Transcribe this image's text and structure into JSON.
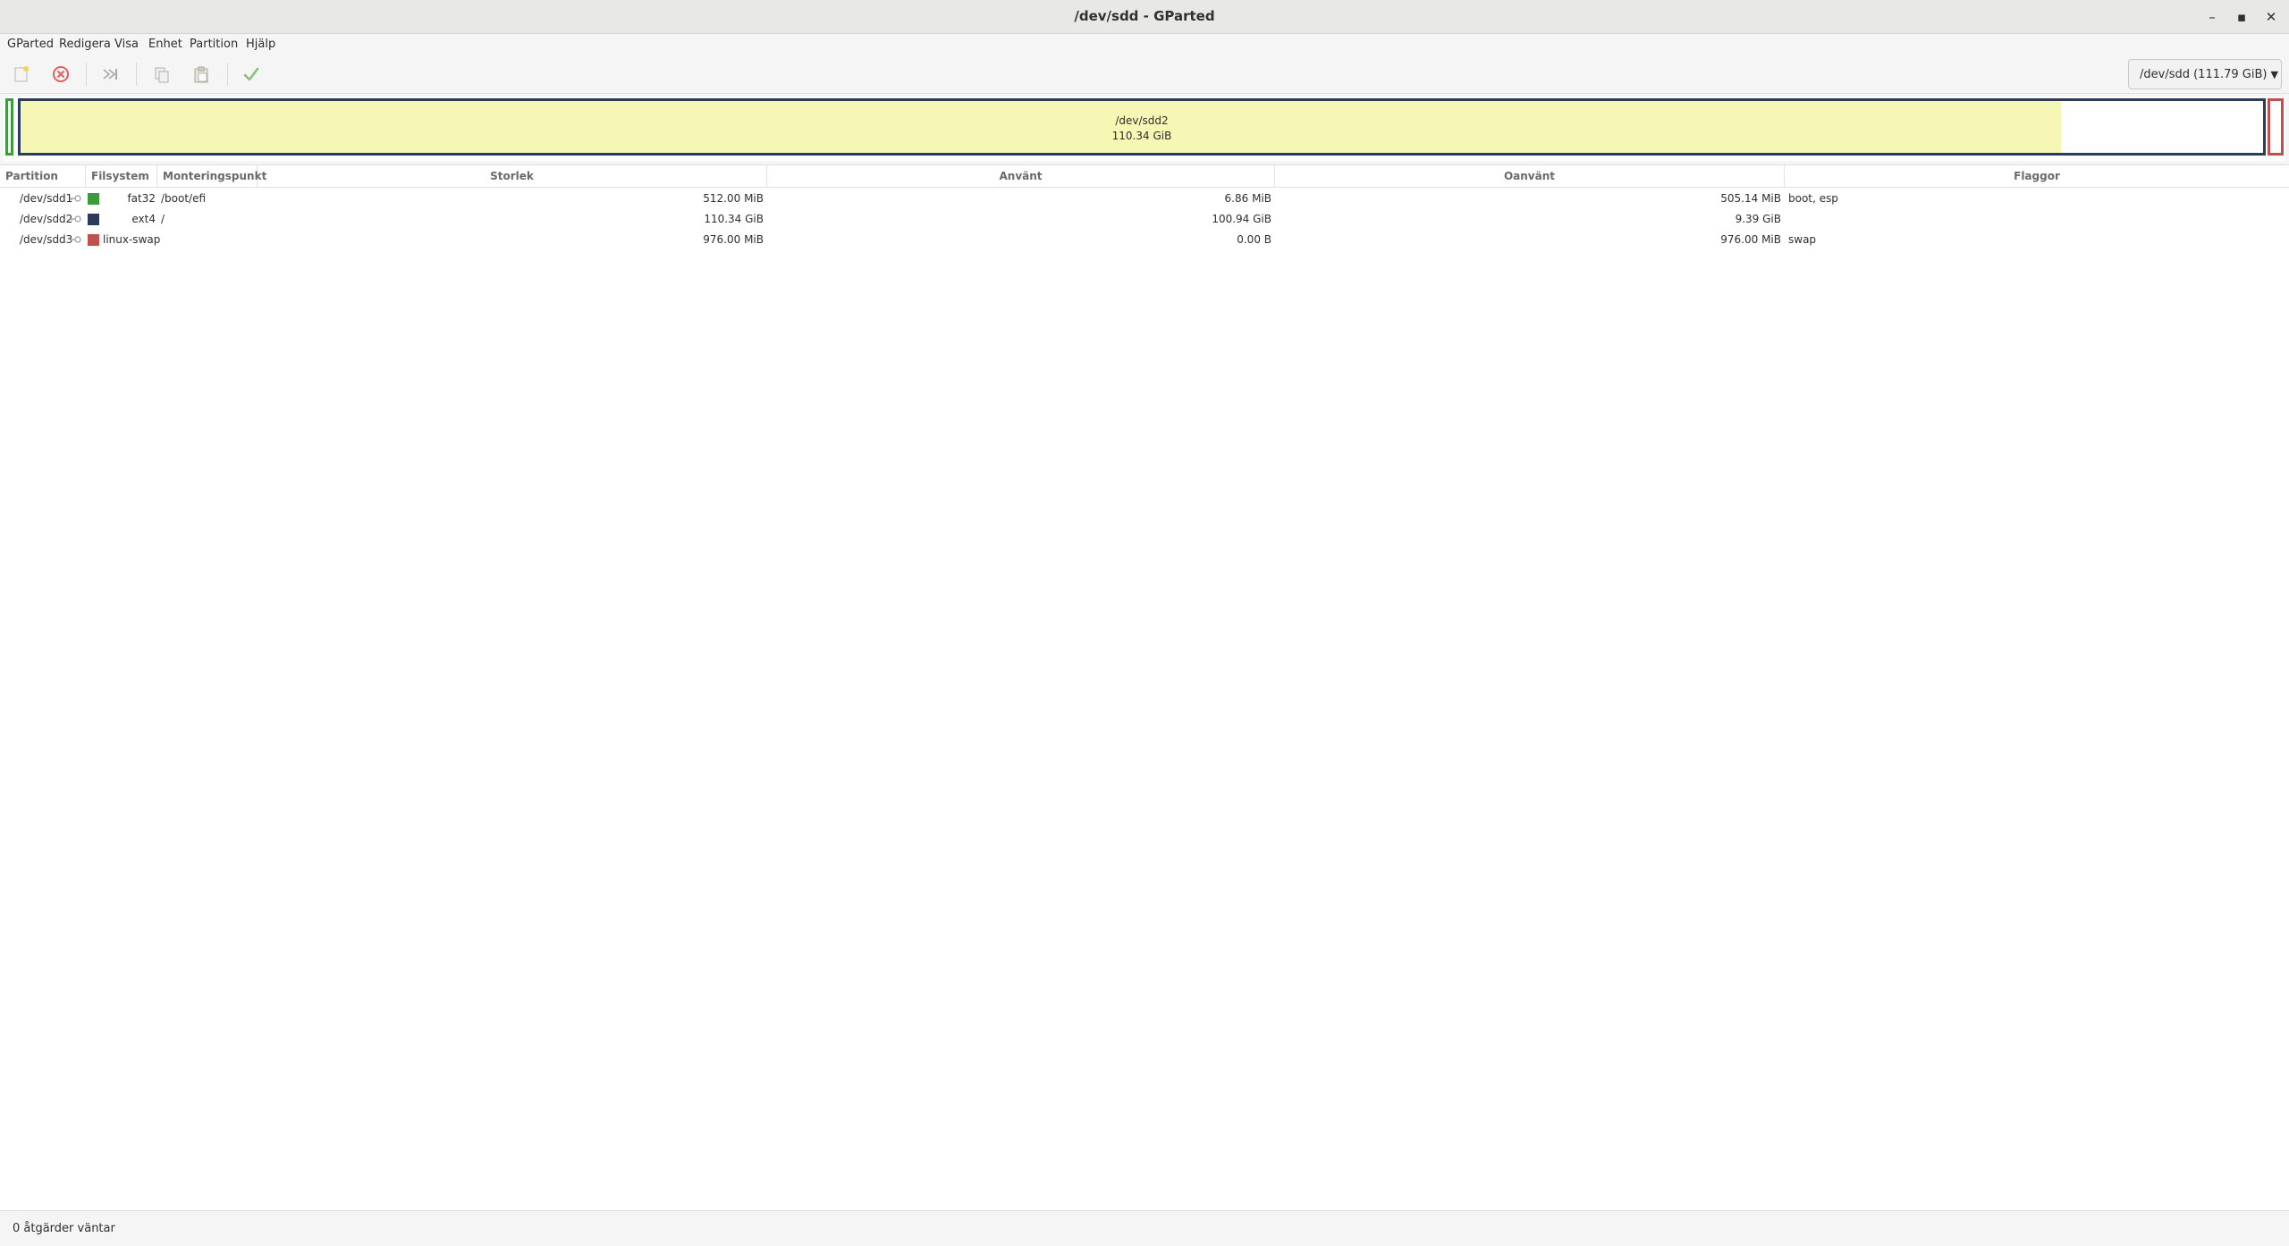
{
  "window": {
    "title": "/dev/sdd - GParted",
    "controls": [
      "–",
      "▪",
      "✕"
    ]
  },
  "menu": [
    "GParted",
    "Redigera",
    "Visa",
    "Enhet",
    "Partition",
    "Hjälp"
  ],
  "toolbar": {
    "icons": [
      "new-partition-icon",
      "delete-icon",
      "resize-move-icon",
      "copy-icon",
      "paste-icon",
      "apply-icon"
    ],
    "device_label": "/dev/sdd (111.79 GiB)"
  },
  "partition_map": {
    "selected_name": "/dev/sdd2",
    "selected_size": "110.34 GiB",
    "selected_used_fraction": 0.91,
    "colors": {
      "fat32": "#3d9a3d",
      "ext4": "#2a3c5a",
      "linux-swap": "#c05050",
      "used_fill": "#f7f7b5"
    }
  },
  "table": {
    "headers": [
      "Partition",
      "Filsystem",
      "Monteringspunkt",
      "Storlek",
      "Använt",
      "Oanvänt",
      "Flaggor"
    ],
    "rows": [
      {
        "partition": "/dev/sdd1",
        "filesystem": "fat32",
        "color": "#3d9a3d",
        "mount": "/boot/efi",
        "size": "512.00 MiB",
        "used": "6.86 MiB",
        "unused": "505.14 MiB",
        "flags": "boot, esp"
      },
      {
        "partition": "/dev/sdd2",
        "filesystem": "ext4",
        "color": "#2a3c5a",
        "mount": "/",
        "size": "110.34 GiB",
        "used": "100.94 GiB",
        "unused": "9.39 GiB",
        "flags": ""
      },
      {
        "partition": "/dev/sdd3",
        "filesystem": "linux-swap",
        "color": "#c05050",
        "mount": "",
        "size": "976.00 MiB",
        "used": "0.00 B",
        "unused": "976.00 MiB",
        "flags": "swap"
      }
    ]
  },
  "status": "0 åtgärder väntar"
}
